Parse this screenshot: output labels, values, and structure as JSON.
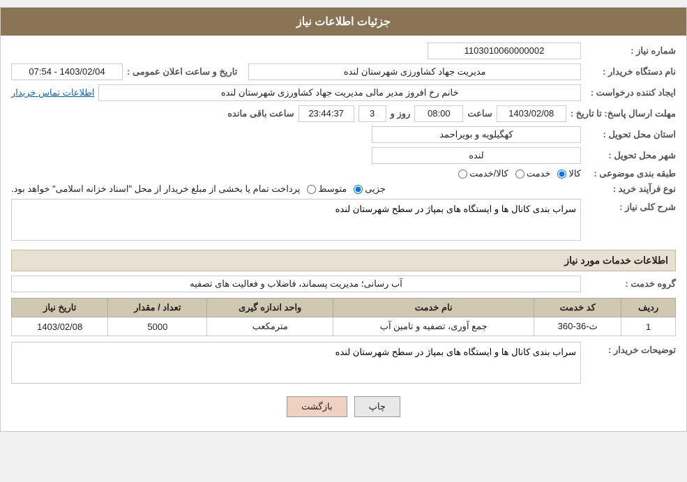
{
  "header": {
    "title": "جزئیات اطلاعات نیاز"
  },
  "fields": {
    "need_number_label": "شماره نیاز :",
    "need_number_value": "1103010060000002",
    "buyer_org_label": "نام دستگاه خریدار :",
    "buyer_org_value": "مدیریت جهاد کشاورزی شهرستان لنده",
    "announcement_label": "تاریخ و ساعت اعلان عمومی :",
    "announcement_value": "1403/02/04 - 07:54",
    "creator_label": "ایجاد کننده درخواست :",
    "creator_value": "خانم رخ افروز مدیر مالی مدیریت جهاد کشاورزی شهرستان لنده",
    "contact_link": "اطلاعات تماس خریدار",
    "reply_deadline_label": "مهلت ارسال پاسخ: تا تاریخ :",
    "reply_date": "1403/02/08",
    "reply_time_label": "ساعت",
    "reply_time": "08:00",
    "reply_days_label": "روز و",
    "reply_days": "3",
    "remaining_label": "ساعت باقی مانده",
    "remaining_time": "23:44:37",
    "province_label": "استان محل تحویل :",
    "province_value": "کهگیلویه و بویراحمد",
    "city_label": "شهر محل تحویل :",
    "city_value": "لنده",
    "category_label": "طبقه بندی موضوعی :",
    "category_kala": "کالا",
    "category_khadamat": "خدمت",
    "category_kala_khadamat": "کالا/خدمت",
    "purchase_type_label": "نوع فرآیند خرید :",
    "purchase_jozei": "جزیی",
    "purchase_motaset": "متوسط",
    "purchase_note": "پرداخت تمام یا بخشی از مبلغ خریدار از محل \"اسناد خزانه اسلامی\" خواهد بود.",
    "need_desc_label": "شرح کلی نیاز :",
    "need_desc_value": "سراب بندی کانال ها و ایستگاه های بمپاژ در سطح شهرستان لنده"
  },
  "services_section": {
    "title": "اطلاعات خدمات مورد نیاز",
    "group_label": "گروه خدمت :",
    "group_value": "آب رسانی؛ مدیریت پسماند، فاضلاب و فعالیت های تصفیه",
    "table": {
      "headers": [
        "ردیف",
        "کد خدمت",
        "نام خدمت",
        "واحد اندازه گیری",
        "تعداد / مقدار",
        "تاریخ نیاز"
      ],
      "rows": [
        {
          "row_num": "1",
          "service_code": "ث-36-360",
          "service_name": "جمع آوری، تصفیه و تامین آب",
          "unit": "مترمکعب",
          "quantity": "5000",
          "date": "1403/02/08"
        }
      ]
    }
  },
  "buyer_desc_label": "توضیحات خریدار :",
  "buyer_desc_value": "سراب بندی کانال ها و ایستگاه های بمپاژ در سطح شهرستان لنده",
  "buttons": {
    "print": "چاپ",
    "back": "بازگشت"
  }
}
